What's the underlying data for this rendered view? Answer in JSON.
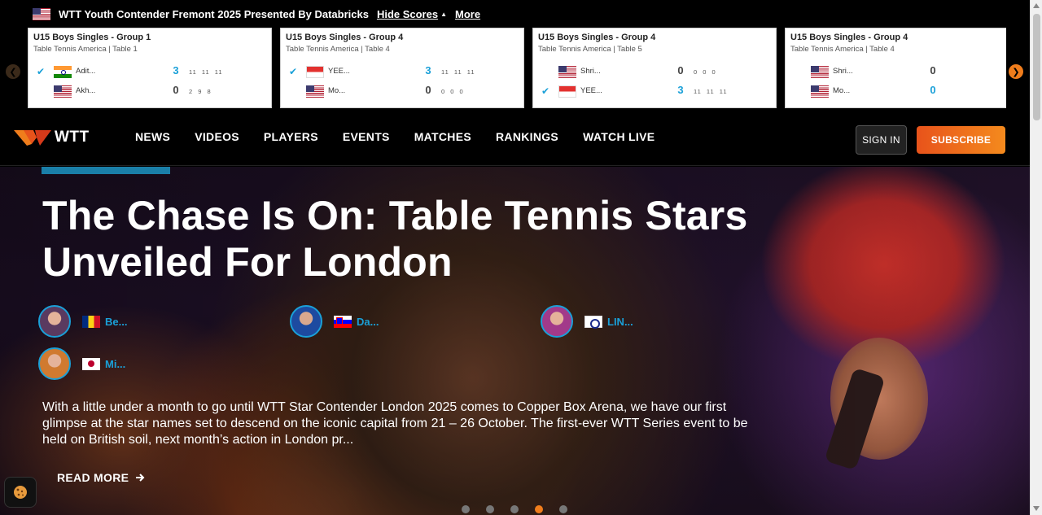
{
  "scorebar": {
    "event_title": "WTT Youth Contender Fremont 2025 Presented By Databricks",
    "hide_scores": "Hide Scores",
    "more": "More",
    "cards": [
      {
        "title": "U15 Boys Singles - Group 1",
        "sub": "Table Tennis America | Table 1",
        "players": [
          {
            "flag": "india-flag-icon",
            "name": "Adit...",
            "score": "3",
            "games": "11 11 11",
            "winner": true
          },
          {
            "flag": "usa-flag-icon",
            "name": "Akh...",
            "score": "0",
            "games": "2 9 8",
            "winner": false
          }
        ]
      },
      {
        "title": "U15 Boys Singles - Group 4",
        "sub": "Table Tennis America | Table 4",
        "players": [
          {
            "flag": "singapore-flag-icon",
            "name": "YEE...",
            "score": "3",
            "games": "11 11 11",
            "winner": true
          },
          {
            "flag": "usa-flag-icon",
            "name": "Mo...",
            "score": "0",
            "games": "0 0 0",
            "winner": false
          }
        ]
      },
      {
        "title": "U15 Boys Singles - Group 4",
        "sub": "Table Tennis America | Table 5",
        "players": [
          {
            "flag": "usa-flag-icon",
            "name": "Shri...",
            "score": "0",
            "games": "0 0 0",
            "winner": false
          },
          {
            "flag": "singapore-flag-icon",
            "name": "YEE...",
            "score": "3",
            "games": "11 11 11",
            "winner": true
          }
        ]
      },
      {
        "title": "U15 Boys Singles - Group 4",
        "sub": "Table Tennis America | Table 4",
        "players": [
          {
            "flag": "usa-flag-icon",
            "name": "Shri...",
            "score": "0",
            "games": "",
            "winner": false
          },
          {
            "flag": "usa-flag-icon",
            "name": "Mo...",
            "score": "0",
            "games": "",
            "winner": false,
            "live": true
          }
        ]
      }
    ]
  },
  "nav": {
    "logo_text": "WTT",
    "items": [
      "NEWS",
      "VIDEOS",
      "PLAYERS",
      "EVENTS",
      "MATCHES",
      "RANKINGS",
      "WATCH LIVE"
    ],
    "sign_in": "SIGN IN",
    "subscribe": "SUBSCRIBE"
  },
  "hero": {
    "headline": "The Chase Is On: Table Tennis Stars Unveiled For London",
    "players": [
      {
        "name": "Be...",
        "flag": "romania-flag-icon"
      },
      {
        "name": "Da...",
        "flag": "slovenia-flag-icon"
      },
      {
        "name": "LIN...",
        "flag": "chinese-taipei-flag-icon"
      },
      {
        "name": "Mi...",
        "flag": "japan-flag-icon"
      }
    ],
    "excerpt": "With a little under a month to go until WTT Star Contender London 2025 comes to Copper Box Arena, we have our first glimpse at the star names set to descend on the iconic capital from 21 – 26 October. The first-ever WTT Series event to be held on British soil, next month’s action in London pr...",
    "read_more": "READ MORE",
    "slides_total": 5,
    "active_slide": 4
  },
  "colors": {
    "accent_blue": "#1aa0d8",
    "accent_orange": "#f07d1c",
    "subscribe_gradient_start": "#e8531b"
  }
}
